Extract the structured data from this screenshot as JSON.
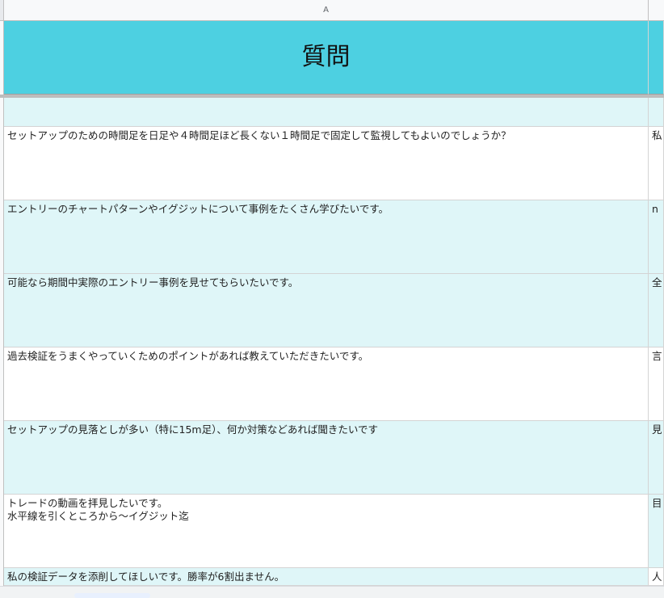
{
  "columns": {
    "a": "A"
  },
  "title": "質問",
  "rows": [
    {
      "question": "",
      "answer_preview": ""
    },
    {
      "question": "セットアップのための時間足を日足や４時間足ほど長くない１時間足で固定して監視してもよいのでしょうか？",
      "answer_preview": "私"
    },
    {
      "question": "エントリーのチャートパターンやイグジットについて事例をたくさん学びたいです。",
      "answer_preview": "n"
    },
    {
      "question": "可能なら期間中実際のエントリー事例を見せてもらいたいです。",
      "answer_preview": "全"
    },
    {
      "question": "過去検証をうまくやっていくためのポイントがあれば教えていただきたいです。",
      "answer_preview": "言"
    },
    {
      "question": "セットアップの見落としが多い（特に15m足）、何か対策などあれば聞きたいです",
      "answer_preview": "見"
    },
    {
      "question": "トレードの動画を拝見したいです。\n水平線を引くところから～イグジット迄",
      "answer_preview": "目"
    },
    {
      "question": "私の検証データを添削してほしいです。勝率が6割出ません。",
      "answer_preview": "人"
    }
  ],
  "colors": {
    "header": "#4dd0e1",
    "band": "#dff6f8",
    "white": "#ffffff"
  }
}
